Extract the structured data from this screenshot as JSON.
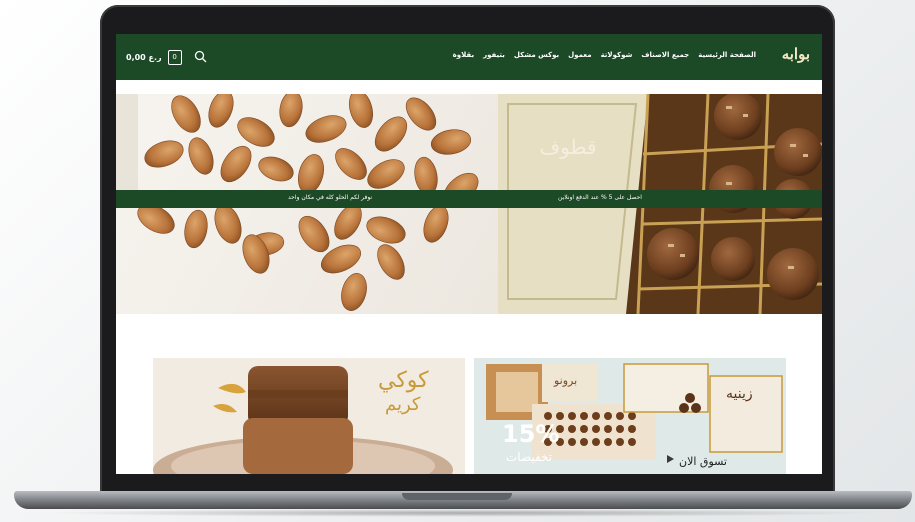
{
  "brand": {
    "logo": "بوابه"
  },
  "nav": {
    "items": [
      "الصفحة الرئيسية",
      "جميع الاصناف",
      "شوكولاتة",
      "معمول",
      "بوكس مشكل",
      "بتيفور",
      "بقلاوة"
    ]
  },
  "cart": {
    "price": "0,00 ر.ع",
    "count": "0"
  },
  "hero": {
    "promo_left": "نوفر لكم الحلو كله في مكان واحد",
    "promo_right": "احصل على 5 % عند الدفع اونلاين"
  },
  "cards": {
    "left": {
      "title_line1": "كوكي",
      "title_line2": "كريم"
    },
    "right": {
      "brand": "برونو",
      "box_name": "زينيه",
      "discount": "15%",
      "discount_label": "تخفيضات",
      "cta": "تسوق الان"
    }
  },
  "colors": {
    "header_green": "#1c4a27",
    "accent_gold": "#c79a3a"
  }
}
